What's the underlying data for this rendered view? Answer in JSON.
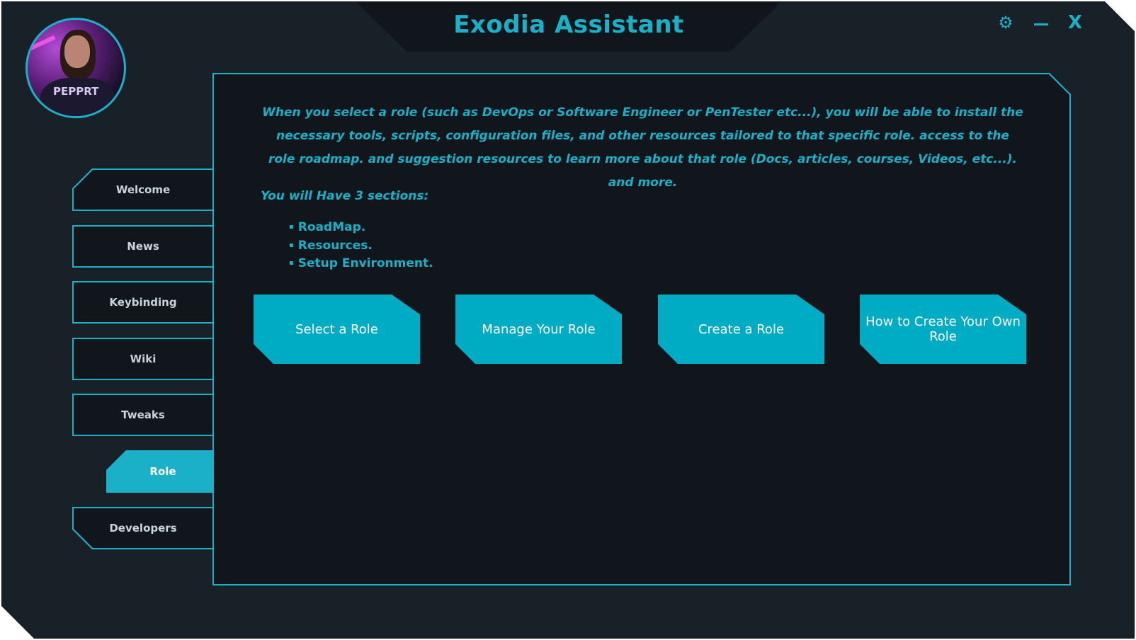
{
  "app": {
    "title": "Exodia Assistant"
  },
  "window_controls": {
    "settings_icon": "gear-icon",
    "settings_glyph": "⚙",
    "minimize_icon": "minimize-icon",
    "close_icon": "close-icon",
    "close_glyph": "X"
  },
  "colors": {
    "accent": "#1ab0c8",
    "button": "#00acc4",
    "background": "#192128",
    "panel": "#10161b"
  },
  "sidebar": {
    "items": [
      {
        "label": "Welcome",
        "active": false
      },
      {
        "label": "News",
        "active": false
      },
      {
        "label": "Keybinding",
        "active": false
      },
      {
        "label": "Wiki",
        "active": false
      },
      {
        "label": "Tweaks",
        "active": false
      },
      {
        "label": "Role",
        "active": true
      },
      {
        "label": "Developers",
        "active": false
      }
    ]
  },
  "main": {
    "intro": "When you select a role (such as DevOps or Software Engineer or PenTester etc...), you will be able to install the necessary tools, scripts, configuration files, and other resources tailored to that specific role. access to the role roadmap. and suggestion resources to learn more about that role (Docs, articles, courses, Videos, etc...). and more.",
    "sections_title": "You will Have 3 sections:",
    "sections": [
      "RoadMap.",
      "Resources.",
      "Setup Environment."
    ],
    "buttons": [
      {
        "label": "Select a Role"
      },
      {
        "label": "Manage Your Role"
      },
      {
        "label": "Create a Role"
      },
      {
        "label": "How to Create Your Own Role"
      }
    ]
  }
}
